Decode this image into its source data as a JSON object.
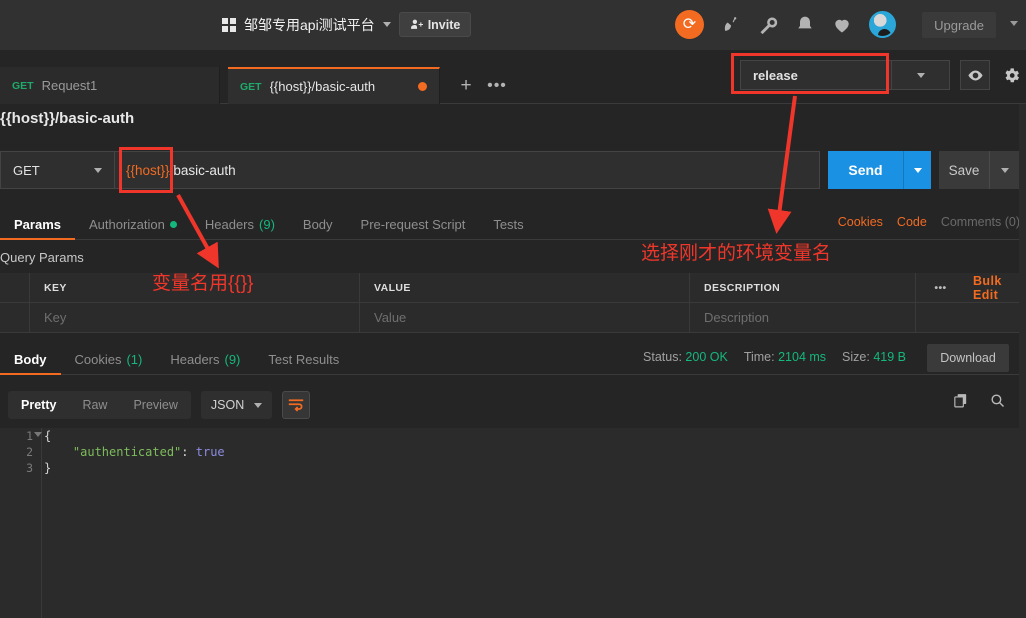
{
  "header": {
    "workspace_name": "邹邹专用api测试平台",
    "invite_label": "Invite",
    "upgrade_label": "Upgrade",
    "icons": [
      "grid-icon",
      "sync-icon",
      "satellite-icon",
      "wrench-icon",
      "bell-icon",
      "heart-icon",
      "avatar"
    ]
  },
  "tabs": [
    {
      "method": "GET",
      "label": "Request1",
      "unsaved": false
    },
    {
      "method": "GET",
      "label": "{{host}}/basic-auth",
      "unsaved": true
    }
  ],
  "tab_actions": {
    "new_tab": "+",
    "more": "•••"
  },
  "environment": {
    "selected": "release",
    "eye_icon": "eye-icon",
    "gear_icon": "gear-icon"
  },
  "request": {
    "title": "{{host}}/basic-auth",
    "method": "GET",
    "url_variable": "{{host}}",
    "url_path": "/basic-auth",
    "send_label": "Send",
    "save_label": "Save"
  },
  "request_tabs": [
    {
      "label": "Params",
      "active": true,
      "badge": ""
    },
    {
      "label": "Authorization",
      "active": false,
      "badge": "dot"
    },
    {
      "label": "Headers",
      "active": false,
      "badge": "(9)"
    },
    {
      "label": "Body",
      "active": false,
      "badge": ""
    },
    {
      "label": "Pre-request Script",
      "active": false,
      "badge": ""
    },
    {
      "label": "Tests",
      "active": false,
      "badge": ""
    }
  ],
  "request_tabs_right": {
    "cookies": "Cookies",
    "code": "Code",
    "comments": "Comments (0)"
  },
  "query_params": {
    "section_label": "Query Params",
    "columns": [
      "KEY",
      "VALUE",
      "DESCRIPTION"
    ],
    "more_label": "•••",
    "bulk_edit_label": "Bulk Edit",
    "placeholder_key": "Key",
    "placeholder_value": "Value",
    "placeholder_description": "Description"
  },
  "response": {
    "tabs": [
      {
        "label": "Body",
        "active": true,
        "badge": ""
      },
      {
        "label": "Cookies",
        "active": false,
        "badge": "(1)"
      },
      {
        "label": "Headers",
        "active": false,
        "badge": "(9)"
      },
      {
        "label": "Test Results",
        "active": false,
        "badge": ""
      }
    ],
    "status_label": "Status:",
    "status_value": "200 OK",
    "time_label": "Time:",
    "time_value": "2104 ms",
    "size_label": "Size:",
    "size_value": "419 B",
    "download_label": "Download",
    "view_modes": [
      "Pretty",
      "Raw",
      "Preview"
    ],
    "active_view_mode": "Pretty",
    "format": "JSON",
    "wrap_icon": "word-wrap-icon",
    "copy_icon": "copy-icon",
    "search_icon": "search-icon",
    "body_lines": [
      "1",
      "2",
      "3"
    ],
    "body_code": {
      "open_brace": "{",
      "key": "\"authenticated\"",
      "colon": ":",
      "value": "true",
      "close_brace": "}"
    }
  },
  "annotations": {
    "variable_note": "变量名用{{}}",
    "environment_note": "选择刚才的环境变量名",
    "highlight_color": "#f0362a"
  }
}
